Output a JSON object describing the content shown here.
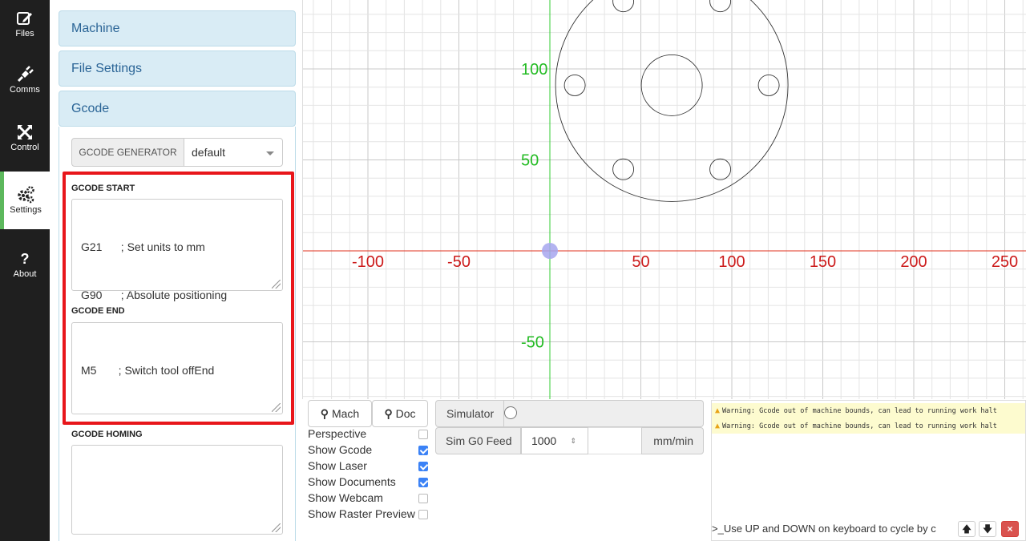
{
  "nav": {
    "items": [
      {
        "label": "Files",
        "icon": "pencil-square-icon"
      },
      {
        "label": "Comms",
        "icon": "plug-icon"
      },
      {
        "label": "Control",
        "icon": "arrows-icon"
      },
      {
        "label": "Settings",
        "icon": "cogs-icon"
      },
      {
        "label": "About",
        "icon": "question-icon"
      }
    ],
    "active": "Settings"
  },
  "settings": {
    "sections": [
      "Machine",
      "File Settings",
      "Gcode"
    ],
    "generator_button": "GCODE GENERATOR",
    "generator_value": "default",
    "gcode_start_label": "GCODE START",
    "gcode_start_lines": [
      "G21      ; Set units to mm",
      "G90      ; Absolute positioning"
    ],
    "gcode_end_label": "GCODE END",
    "gcode_end_lines": [
      "M5       ; Switch tool offEnd"
    ],
    "gcode_homing_label": "GCODE HOMING",
    "gcode_homing_lines": []
  },
  "viewport": {
    "x_ticks": [
      "-100",
      "-50",
      "50",
      "100",
      "150",
      "200",
      "250"
    ],
    "y_ticks": [
      "100",
      "50",
      "-50"
    ],
    "x_axis_color": "#e0301e",
    "y_axis_color": "#33cc33",
    "x_label_color": "#cc1a1a",
    "y_label_color": "#22bb22"
  },
  "controls": {
    "mach_button": "Mach",
    "doc_button": "Doc",
    "simulator_label": "Simulator",
    "sim_feed_label": "Sim G0 Feed",
    "sim_feed_value": "1000",
    "sim_feed_unit": "mm/min",
    "options": [
      {
        "label": "Perspective",
        "checked": false
      },
      {
        "label": "Show Gcode",
        "checked": true
      },
      {
        "label": "Show Laser",
        "checked": true
      },
      {
        "label": "Show Documents",
        "checked": true
      },
      {
        "label": "Show Webcam",
        "checked": false
      },
      {
        "label": "Show Raster Preview",
        "checked": false
      }
    ]
  },
  "console": {
    "warnings": [
      "Warning: Gcode out of machine bounds, can lead to running work halt",
      "Warning: Gcode out of machine bounds, can lead to running work halt"
    ],
    "prompt": ">_Use UP and DOWN on keyboard to cycle by c"
  }
}
